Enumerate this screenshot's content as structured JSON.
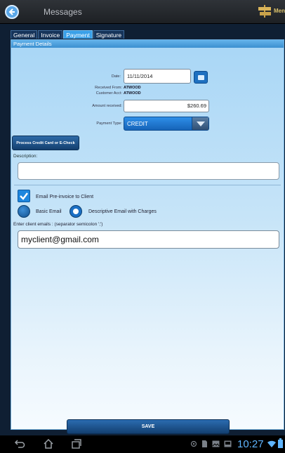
{
  "actionbar": {
    "title": "Messages",
    "menu_label": "Menu"
  },
  "tabs": [
    {
      "label": "General"
    },
    {
      "label": "Invoice"
    },
    {
      "label": "Payment"
    },
    {
      "label": "Signature"
    }
  ],
  "active_tab": "Payment",
  "panel": {
    "header": "Payment Details",
    "date_label": "Date:",
    "date_value": "11/11/2014",
    "received_from_label": "Received From:",
    "received_from_value": "ATWOOD",
    "customer_acct_label": "Customer Acct:",
    "customer_acct_value": "ATWOOD",
    "amount_label": "Amount received:",
    "amount_value": "$260.69",
    "payment_type_label": "Payment Type:",
    "payment_type_value": "CREDIT",
    "process_button": "Process Credit Card or E-Check",
    "description_label": "Description:",
    "description_value": "",
    "email_checkbox_label": "Email Pre-invoice to Client",
    "email_checkbox_checked": true,
    "radio_basic_label": "Basic Email",
    "radio_descriptive_label": "Descriptive Email with Charges",
    "selected_email_type": "Descriptive Email with Charges",
    "client_emails_label": "Enter client emails : (separator semicolon ';')",
    "client_emails_value": "myclient@gmail.com"
  },
  "save_button": "SAVE",
  "statusbar": {
    "time": "10:27"
  },
  "colors": {
    "accent": "#1e70c0",
    "panel_top": "#a8d6f6",
    "clock": "#5fb5ff"
  }
}
